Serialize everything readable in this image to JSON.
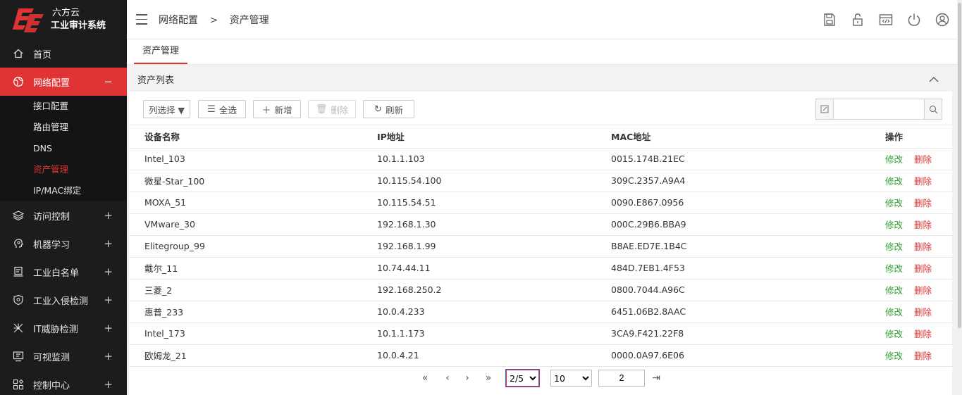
{
  "brand": {
    "line1": "六方云",
    "line2": "工业审计系统"
  },
  "colors": {
    "accent": "#e03434",
    "sidebar_bg": "#1c1c1c",
    "edit": "#2e9e2e"
  },
  "sidebar": {
    "items": [
      {
        "label": "首页",
        "icon": "home-icon"
      },
      {
        "label": "网络配置",
        "icon": "globe-icon",
        "toggle": "−",
        "active": true
      },
      {
        "label": "访问控制",
        "icon": "layers-icon",
        "toggle": "+"
      },
      {
        "label": "机器学习",
        "icon": "brain-icon",
        "toggle": "+"
      },
      {
        "label": "工业白名单",
        "icon": "id-card-icon",
        "toggle": "+"
      },
      {
        "label": "工业入侵检测",
        "icon": "shield-icon",
        "toggle": "+"
      },
      {
        "label": "IT威胁检测",
        "icon": "network-icon",
        "toggle": "+"
      },
      {
        "label": "可视监测",
        "icon": "monitor-icon",
        "toggle": "+"
      },
      {
        "label": "控制中心",
        "icon": "grid-icon",
        "toggle": "+"
      }
    ],
    "subitems": [
      "接口配置",
      "路由管理",
      "DNS",
      "资产管理",
      "IP/MAC绑定"
    ]
  },
  "breadcrumb": {
    "parent": "网络配置",
    "sep": ">",
    "current": "资产管理"
  },
  "tab": {
    "label": "资产管理"
  },
  "panel": {
    "title": "资产列表"
  },
  "toolbar": {
    "column_select": "列选择 ▼",
    "select_all": "全选",
    "add": "新增",
    "delete": "删除",
    "refresh": "刷新",
    "search_value": ""
  },
  "table": {
    "headers": [
      "设备名称",
      "IP地址",
      "MAC地址",
      "操作"
    ],
    "rows": [
      {
        "name": "Intel_103",
        "ip": "10.1.1.103",
        "mac": "0015.174B.21EC"
      },
      {
        "name": "微星-Star_100",
        "ip": "10.115.54.100",
        "mac": "309C.2357.A9A4"
      },
      {
        "name": "MOXA_51",
        "ip": "10.115.54.51",
        "mac": "0090.E867.0956"
      },
      {
        "name": "VMware_30",
        "ip": "192.168.1.30",
        "mac": "000C.29B6.BBA9"
      },
      {
        "name": "Elitegroup_99",
        "ip": "192.168.1.99",
        "mac": "B8AE.ED7E.1B4C"
      },
      {
        "name": "戴尔_11",
        "ip": "10.74.44.11",
        "mac": "484D.7EB1.4F53"
      },
      {
        "name": "三菱_2",
        "ip": "192.168.250.2",
        "mac": "0800.7044.A96C"
      },
      {
        "name": "惠普_233",
        "ip": "10.0.4.233",
        "mac": "6451.06B2.8AAC"
      },
      {
        "name": "Intel_173",
        "ip": "10.1.1.173",
        "mac": "3CA9.F421.22F8"
      },
      {
        "name": "欧姆龙_21",
        "ip": "10.0.4.21",
        "mac": "0000.0A97.6E06"
      }
    ],
    "edit_label": "修改",
    "delete_label": "删除"
  },
  "pager": {
    "page": "2/5",
    "page_size": "10",
    "goto": "2"
  }
}
